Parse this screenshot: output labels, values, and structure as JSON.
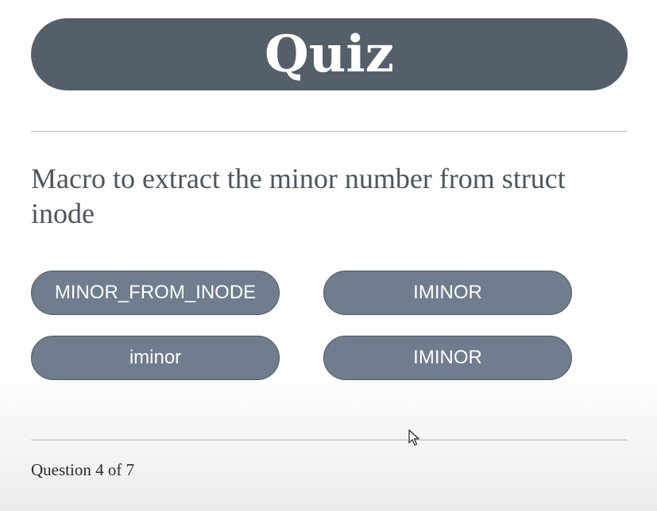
{
  "quiz": {
    "title": "Quiz",
    "question": "Macro to extract the minor number from struct inode",
    "answers": [
      "MINOR_FROM_INODE",
      "IMINOR",
      "iminor",
      "IMINOR"
    ],
    "progress_text": "Question 4 of 7"
  },
  "colors": {
    "banner": "#555f6a",
    "answer_button": "#6f7d8e"
  },
  "icons": {
    "cursor": "mouse-pointer-icon"
  }
}
